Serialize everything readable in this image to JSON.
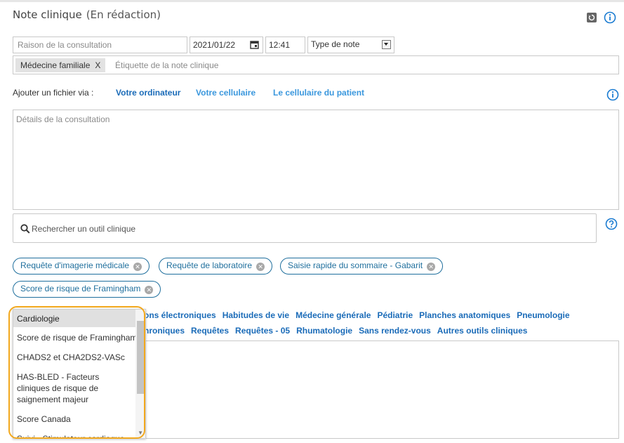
{
  "note": {
    "title": "Note clinique",
    "status": "(En rédaction)"
  },
  "form": {
    "reason_placeholder": "Raison de la consultation",
    "date": "2021/01/22",
    "time": "12:41",
    "note_type": "Type de note",
    "tag_chip": "Médecine familiale",
    "tag_remove": "X",
    "tag_placeholder": "Étiquette de la note clinique",
    "details_placeholder": "Détails de la consultation"
  },
  "attach": {
    "label": "Ajouter un fichier via :",
    "links": [
      "Votre ordinateur",
      "Votre cellulaire",
      "Le cellulaire du patient"
    ]
  },
  "search": {
    "placeholder": "Rechercher un outil clinique"
  },
  "pills": [
    "Requête d'imagerie médicale",
    "Requête de laboratoire",
    "Saisie rapide du sommaire - Gabarit",
    "Score de risque de Framingham"
  ],
  "categories": {
    "row1": [
      "ons électroniques",
      "Habitudes de vie",
      "Médecine générale",
      "Pédiatrie",
      "Planches anatomiques",
      "Pneumologie"
    ],
    "row2": [
      "nroniques",
      "Requêtes",
      "Requêtes - 05",
      "Rhumatologie",
      "Sans rendez-vous",
      "Autres outils cliniques"
    ]
  },
  "dropdown": {
    "items": [
      "Cardiologie",
      "Score de risque de Framingham",
      "CHADS2 et CHA2DS2-VASc",
      "HAS-BLED - Facteurs cliniques de risque de saignement majeur",
      "Score Canada",
      "Suivi - Stimulateur cardiaque"
    ],
    "selected": "Cardiologie"
  },
  "icons": [
    "refresh-icon",
    "info-icon",
    "calendar-icon",
    "chevron-down-icon",
    "search-icon",
    "help-icon",
    "close-circle-icon"
  ],
  "colors": {
    "link": "#2f8fd6",
    "category": "#1a6bb8",
    "pill": "#1f6f9d",
    "highlight": "#f2a81d",
    "info": "#1a7bd1"
  }
}
